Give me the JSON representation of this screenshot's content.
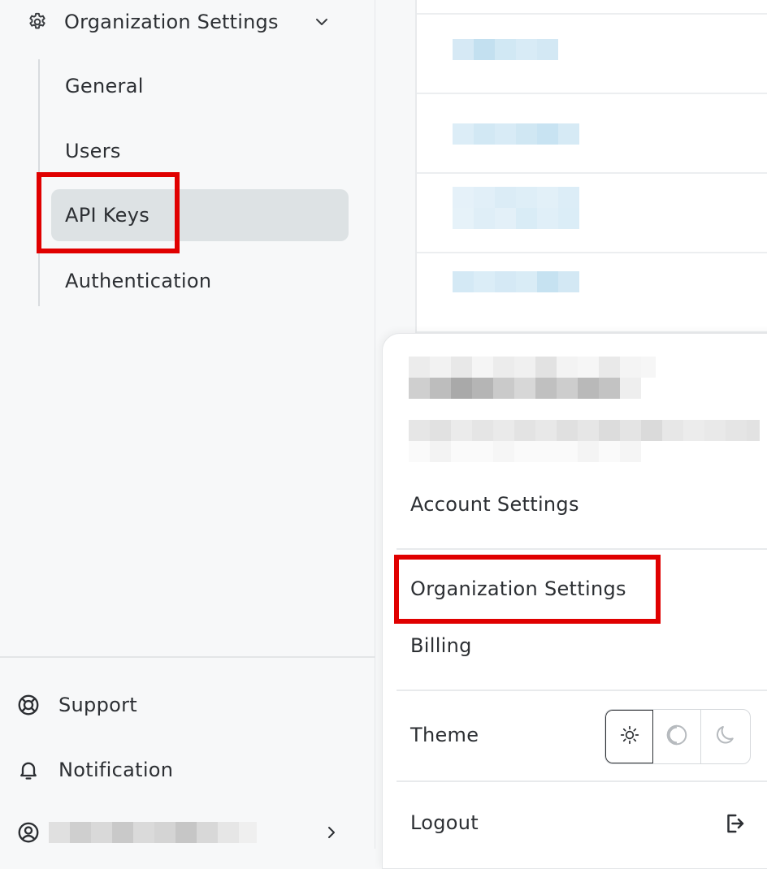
{
  "sidebar": {
    "section_title": "Organization Settings",
    "items": [
      {
        "label": "General"
      },
      {
        "label": "Users"
      },
      {
        "label": "API Keys",
        "active": true
      },
      {
        "label": "Authentication"
      }
    ],
    "bottom": {
      "support": "Support",
      "notification": "Notification"
    }
  },
  "menu": {
    "account_settings": "Account Settings",
    "organization_settings": "Organization Settings",
    "billing": "Billing",
    "theme_label": "Theme",
    "theme_options": [
      "light-theme",
      "system-theme",
      "dark-theme"
    ],
    "logout": "Logout"
  },
  "colors": {
    "highlight": "#e00000",
    "active_item_bg": "#dde2e4",
    "text": "#2c2f33"
  }
}
